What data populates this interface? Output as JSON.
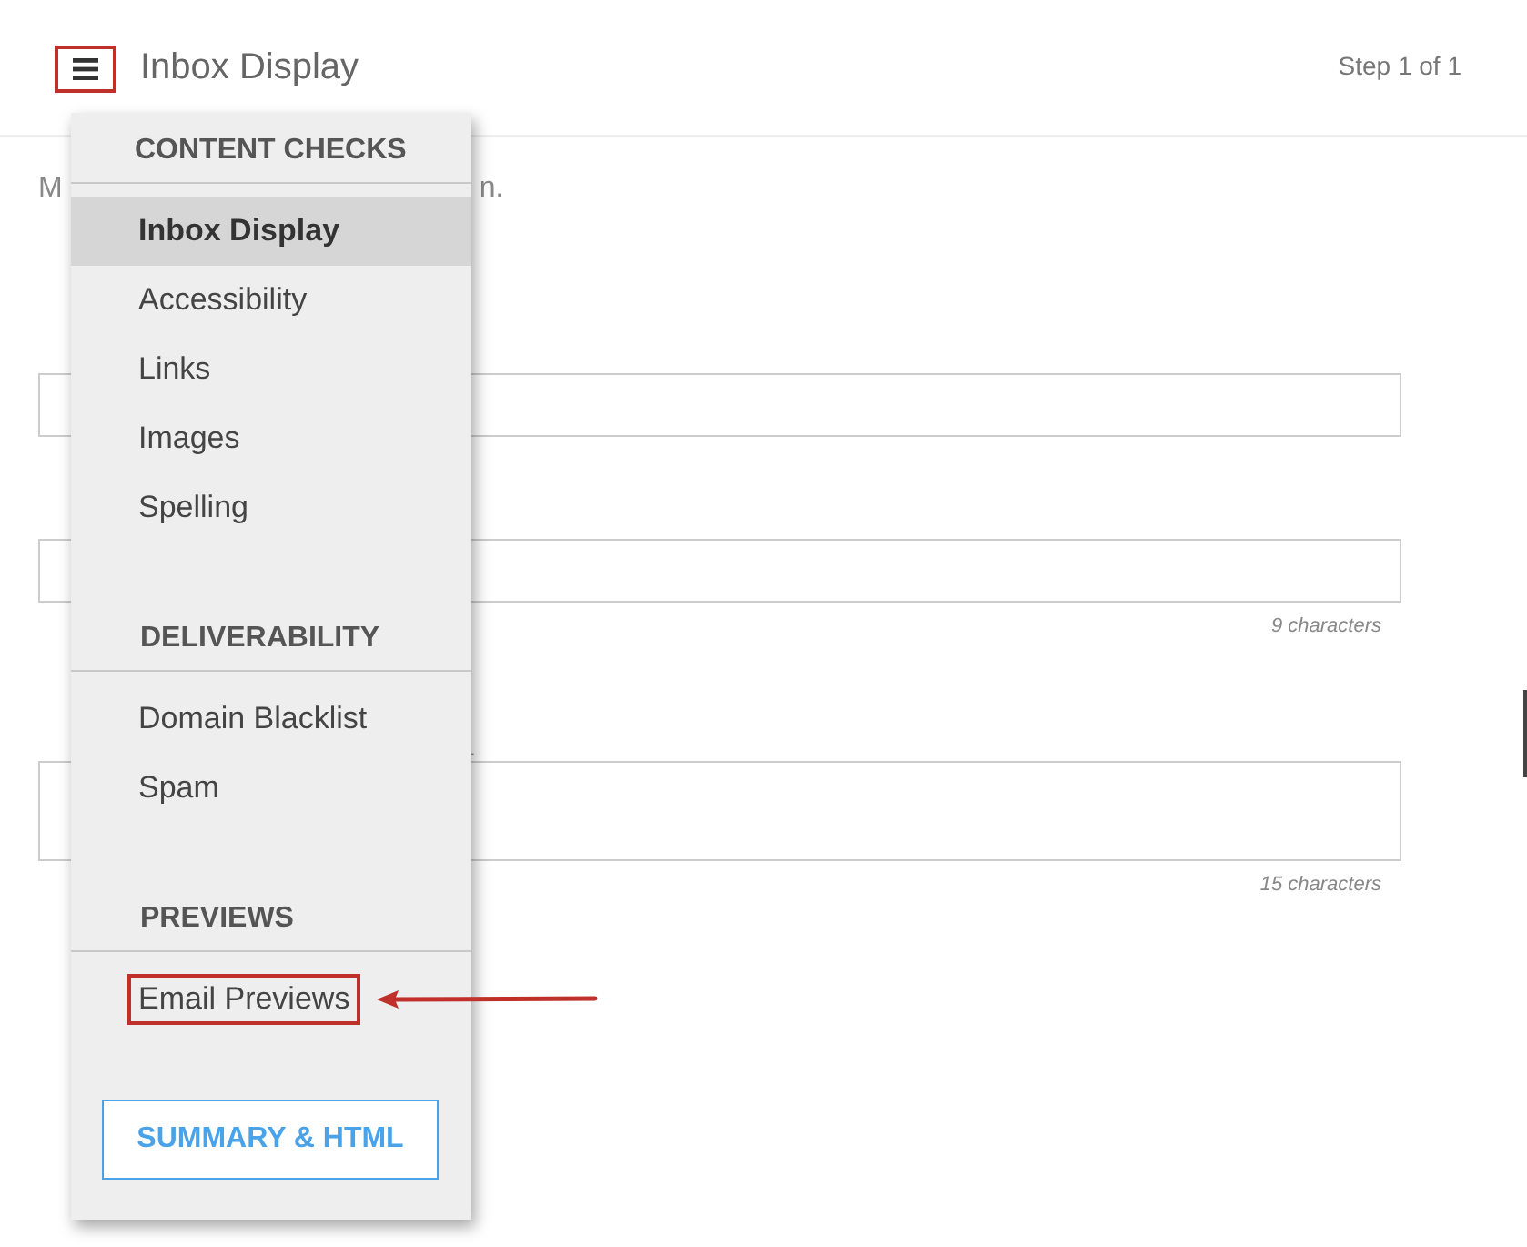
{
  "header": {
    "menu_button": {
      "highlighted": true
    },
    "title": "Inbox Display",
    "step": "Step 1 of 1"
  },
  "page": {
    "intro_parts": [
      "M",
      "n."
    ],
    "fields": [
      {
        "kind": "line"
      },
      {
        "kind": "line",
        "counter": "9 characters"
      },
      {
        "kind": "area",
        "label": ".",
        "counter": "15 characters"
      }
    ]
  },
  "menu": {
    "sections": [
      {
        "heading": "CONTENT CHECKS",
        "items": [
          {
            "label": "Inbox Display",
            "selected": true,
            "highlighted": false
          },
          {
            "label": "Accessibility",
            "selected": false,
            "highlighted": false
          },
          {
            "label": "Links",
            "selected": false,
            "highlighted": false
          },
          {
            "label": "Images",
            "selected": false,
            "highlighted": false
          },
          {
            "label": "Spelling",
            "selected": false,
            "highlighted": false
          }
        ]
      },
      {
        "heading": "DELIVERABILITY",
        "items": [
          {
            "label": "Domain Blacklist",
            "selected": false,
            "highlighted": false
          },
          {
            "label": "Spam",
            "selected": false,
            "highlighted": false
          }
        ]
      },
      {
        "heading": "PREVIEWS",
        "items": [
          {
            "label": "Email Previews",
            "selected": false,
            "highlighted": true
          }
        ]
      }
    ],
    "button": "SUMMARY & HTML"
  }
}
